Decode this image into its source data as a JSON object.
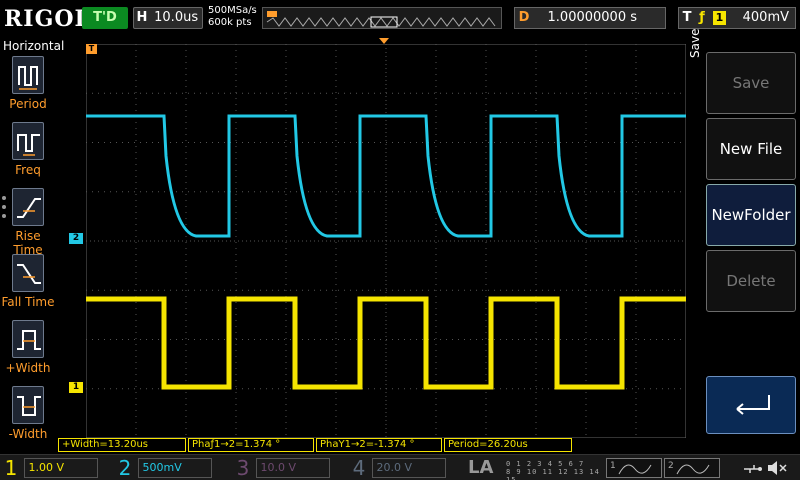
{
  "brand": "RIGOL",
  "run_status": "T'D",
  "horizontal": {
    "label": "H",
    "timebase": "10.0us"
  },
  "sample": {
    "rate": "500MSa/s",
    "points": "600k pts"
  },
  "delay": {
    "label": "D",
    "value": "1.00000000 s"
  },
  "trigger": {
    "label": "T",
    "source": "1",
    "level": "400mV"
  },
  "left_menu": {
    "title": "Horizontal",
    "items": [
      {
        "label": "Period",
        "icon": "period-icon"
      },
      {
        "label": "Freq",
        "icon": "frequency-icon"
      },
      {
        "label": "Rise Time",
        "icon": "rise-time-icon"
      },
      {
        "label": "Fall Time",
        "icon": "fall-time-icon"
      },
      {
        "label": "+Width",
        "icon": "positive-width-icon"
      },
      {
        "label": "-Width",
        "icon": "negative-width-icon"
      }
    ]
  },
  "right_menu": {
    "title": "Save",
    "buttons": [
      {
        "label": "Save",
        "enabled": false
      },
      {
        "label": "New File",
        "enabled": true
      },
      {
        "label": "NewFolder",
        "enabled": true
      },
      {
        "label": "Delete",
        "enabled": false
      }
    ],
    "enter_icon": "enter-arrow-icon"
  },
  "measurements": [
    {
      "text": "+Width=13.20us"
    },
    {
      "text": "Phaƒ1→2=1.374 °"
    },
    {
      "text": "PhaŸ1→2=-1.374 °"
    },
    {
      "text": "Period=26.20us"
    }
  ],
  "channels": [
    {
      "number": "1",
      "scale": "1.00 V",
      "color": "#f5e400"
    },
    {
      "number": "2",
      "scale": "500mV",
      "color": "#22c8e5"
    },
    {
      "number": "3",
      "scale": "10.0 V",
      "color": "#6d4a6f"
    },
    {
      "number": "4",
      "scale": "20.0 V",
      "color": "#5d6b7c"
    }
  ],
  "la": {
    "label": "LA",
    "bits_top": "0 1 2 3 4 5 6 7",
    "bits_bottom": "8 9 10 11 12 13 14 15"
  },
  "generators": [
    {
      "number": "1"
    },
    {
      "number": "2"
    }
  ],
  "waveforms": {
    "period_us": 26.2,
    "high_width_us": 13.2,
    "ch1": {
      "color": "#f5e400",
      "marker": "1"
    },
    "ch2": {
      "color": "#22c8e5",
      "marker": "2"
    },
    "trigger_marker": "T"
  }
}
